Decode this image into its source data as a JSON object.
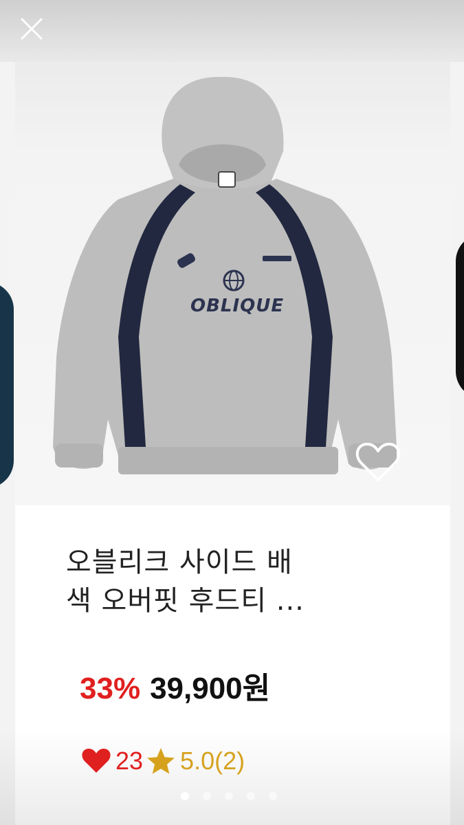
{
  "viewer": {
    "close_icon": "close-icon",
    "pager": {
      "total": 5,
      "active": 1
    }
  },
  "product": {
    "image_print": "OBLIQUE",
    "title_line1": "오블리크 사이드 배",
    "title_line2": "색 오버핏 후드티 ...",
    "discount": "33%",
    "price": "39,900원",
    "likes": "23",
    "rating": "5.0(2)",
    "wishlist_icon": "heart-outline-icon"
  },
  "colors": {
    "discount": "#e0201f",
    "rating": "#d6a21e",
    "hoodie_body": "#bdbdbd",
    "hoodie_trim": "#22283f"
  }
}
